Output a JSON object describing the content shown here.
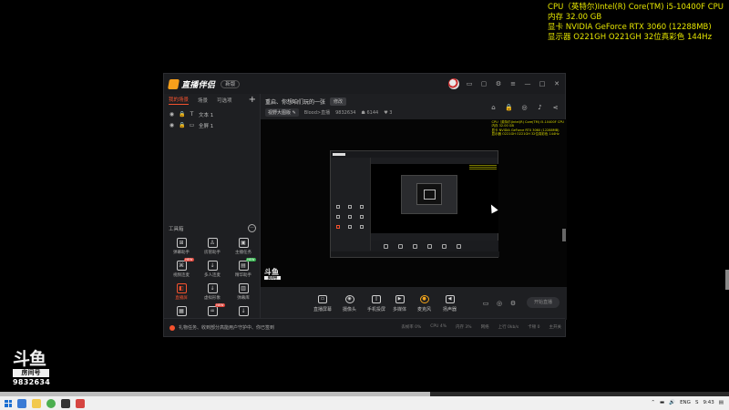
{
  "overlay": {
    "cpu": "CPU（英特尔)Intel(R) Core(TM) i5-10400F CPU",
    "memory": "内存  32.00 GB",
    "gpu": "显卡  NVIDIA GeForce RTX 3060 (12288MB)",
    "display": "显示器  O221GH O221GH 32位真彩色 144Hz"
  },
  "app": {
    "name": "直播伴侣",
    "version": "新版",
    "scene_tabs": [
      "我的场景",
      "场景",
      "可选项"
    ],
    "scenes": [
      "文本 1",
      "全屏 1"
    ],
    "tools_title": "工具箱",
    "tools": [
      {
        "label": "弹幕助手",
        "icon": "⊞",
        "badge": ""
      },
      {
        "label": "房管助手",
        "icon": "♙",
        "badge": ""
      },
      {
        "label": "主播任务",
        "icon": "▣",
        "badge": ""
      },
      {
        "label": "视频连麦",
        "icon": "⌘",
        "badge": "NEW"
      },
      {
        "label": "多人连麦",
        "icon": "↓",
        "badge": ""
      },
      {
        "label": "精华助手",
        "icon": "▤",
        "badge": "NEW"
      },
      {
        "label": "直播屏",
        "icon": "◧",
        "badge": "",
        "active": true
      },
      {
        "label": "虚拟形象",
        "icon": "↓",
        "badge": ""
      },
      {
        "label": "弹幕库",
        "icon": "▥",
        "badge": ""
      },
      {
        "label": "",
        "icon": "▦",
        "badge": ""
      },
      {
        "label": "",
        "icon": "♒",
        "badge": "NEW"
      },
      {
        "label": "",
        "icon": "↓",
        "badge": ""
      }
    ],
    "stream_title": "重启、你想咱们玩的一张",
    "title_edit": "修改",
    "category": "视野大图版",
    "category_sub": "Blood>直播",
    "room_id": "9832634",
    "viewers": "6144",
    "likes": "3",
    "controls": [
      {
        "label": "直播屏幕",
        "icon": "▭"
      },
      {
        "label": "摄像头",
        "icon": "◉"
      },
      {
        "label": "手机投屏",
        "icon": "▯"
      },
      {
        "label": "多媒体",
        "icon": "▶"
      },
      {
        "label": "麦克风",
        "icon": "🎙"
      },
      {
        "label": "扬声器",
        "icon": "◀"
      }
    ],
    "start_label": "开始直播",
    "status_notice": "礼物任务、收到部分高能用户守护中、你已签到",
    "status_right": [
      "丢帧率 0%",
      "CPU 4%",
      "内存 3%",
      "网络",
      "上行 0kb/s",
      "卡顿 0",
      "主开关"
    ]
  },
  "watermark": {
    "logo": "斗鱼",
    "room_label": "房间号",
    "room_id": "9832634"
  },
  "progress": {
    "value": 0.59
  },
  "taskbar": {
    "lang": "ENG",
    "sound": "🔊",
    "time": "9:43"
  }
}
